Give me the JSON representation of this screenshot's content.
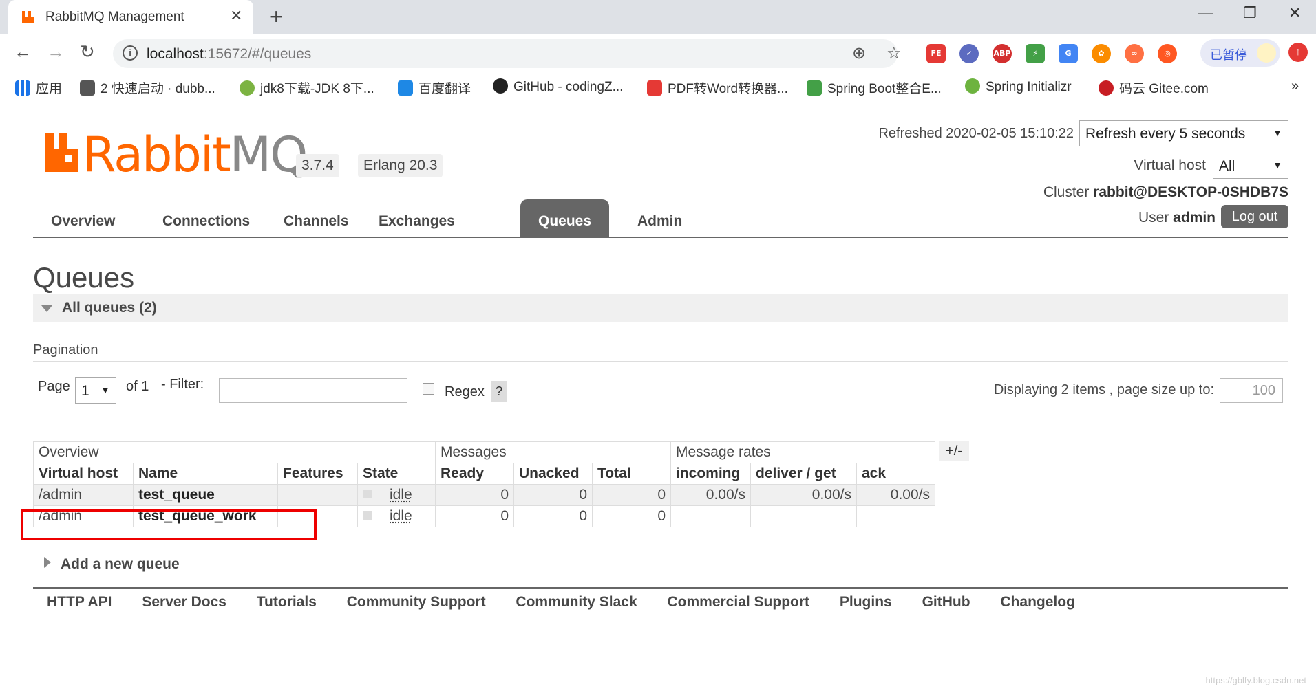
{
  "browser": {
    "tab_title": "RabbitMQ Management",
    "url_host": "localhost",
    "url_rest": ":15672/#/queues",
    "paused_label": "已暂停",
    "bookmarks": [
      {
        "label": "应用"
      },
      {
        "label": "2 快速启动 · dubb..."
      },
      {
        "label": "jdk8下载-JDK 8下..."
      },
      {
        "label": "百度翻译"
      },
      {
        "label": "GitHub - codingZ..."
      },
      {
        "label": "PDF转Word转换器..."
      },
      {
        "label": "Spring Boot整合E..."
      },
      {
        "label": "Spring Initializr"
      },
      {
        "label": "码云 Gitee.com"
      }
    ],
    "more": "»"
  },
  "header": {
    "logo_main": "RabbitMQ",
    "version": "3.7.4",
    "erlang": "Erlang 20.3",
    "refreshed_label": "Refreshed 2020-02-05 15:10:22",
    "refresh_select": "Refresh every 5 seconds",
    "vhost_label": "Virtual host",
    "vhost_select": "All",
    "cluster_label": "Cluster",
    "cluster_name": "rabbit@DESKTOP-0SHDB7S",
    "user_label": "User",
    "user_name": "admin",
    "logout": "Log out"
  },
  "nav_tabs": [
    "Overview",
    "Connections",
    "Channels",
    "Exchanges",
    "Queues",
    "Admin"
  ],
  "page_title": "Queues",
  "section_title": "All queues (2)",
  "pagination": {
    "heading": "Pagination",
    "page_label": "Page",
    "page_value": "1",
    "of_label": "of 1",
    "filter_label": "- Filter:",
    "filter_value": "",
    "regex_label": "Regex",
    "help": "?",
    "display_label": "Displaying 2 items , page size up to:",
    "page_size": "100"
  },
  "table": {
    "groups": [
      "Overview",
      "Messages",
      "Message rates"
    ],
    "toggle": "+/-",
    "columns": [
      "Virtual host",
      "Name",
      "Features",
      "State",
      "Ready",
      "Unacked",
      "Total",
      "incoming",
      "deliver / get",
      "ack"
    ],
    "rows": [
      {
        "vhost": "/admin",
        "name": "test_queue",
        "features": "",
        "state": "idle",
        "ready": "0",
        "unacked": "0",
        "total": "0",
        "incoming": "0.00/s",
        "deliver": "0.00/s",
        "ack": "0.00/s"
      },
      {
        "vhost": "/admin",
        "name": "test_queue_work",
        "features": "",
        "state": "idle",
        "ready": "0",
        "unacked": "0",
        "total": "0",
        "incoming": "",
        "deliver": "",
        "ack": ""
      }
    ]
  },
  "add_queue": "Add a new queue",
  "footer_links": [
    "HTTP API",
    "Server Docs",
    "Tutorials",
    "Community Support",
    "Community Slack",
    "Commercial Support",
    "Plugins",
    "GitHub",
    "Changelog"
  ],
  "watermark": "https://gblfy.blog.csdn.net",
  "colors": {
    "brand": "#ff6600",
    "tab_active": "#666666",
    "highlight": "#ee0000"
  }
}
